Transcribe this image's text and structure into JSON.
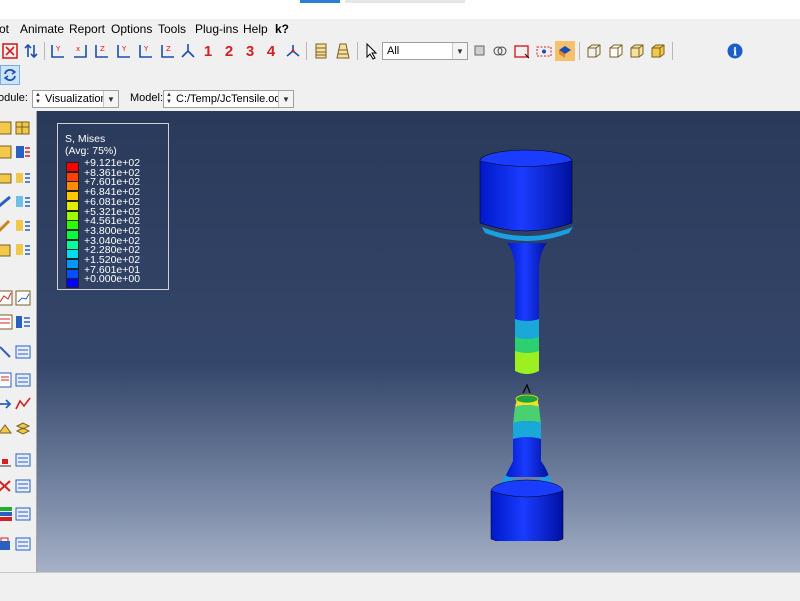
{
  "menu": [
    "ot",
    "Animate",
    "Report",
    "Options",
    "Tools",
    "Plug-ins",
    "Help",
    "k?"
  ],
  "toolbar": {
    "step_numbers": [
      "1",
      "2",
      "3",
      "4"
    ],
    "selection_filter": "All"
  },
  "context": {
    "module_label": "odule:",
    "module_value": "Visualization",
    "model_label": "Model:",
    "model_value": "C:/Temp/JcTensile.odb"
  },
  "legend": {
    "title": "S, Mises",
    "subtitle": "(Avg: 75%)",
    "values": [
      "+9.121e+02",
      "+8.361e+02",
      "+7.601e+02",
      "+6.841e+02",
      "+6.081e+02",
      "+5.321e+02",
      "+4.561e+02",
      "+3.800e+02",
      "+3.040e+02",
      "+2.280e+02",
      "+1.520e+02",
      "+7.601e+01",
      "+0.000e+00"
    ],
    "colors": [
      "#ff0000",
      "#ff4000",
      "#ff8c00",
      "#ffc800",
      "#dcf000",
      "#9cff00",
      "#28ff00",
      "#00ff40",
      "#00ffa0",
      "#00dcf0",
      "#0098ff",
      "#0050ff",
      "#0000ff"
    ]
  },
  "colors": {
    "accent": "#2b7fd4",
    "viewport_top": "#2a3a5a",
    "viewport_bottom": "#a6b1c6"
  }
}
